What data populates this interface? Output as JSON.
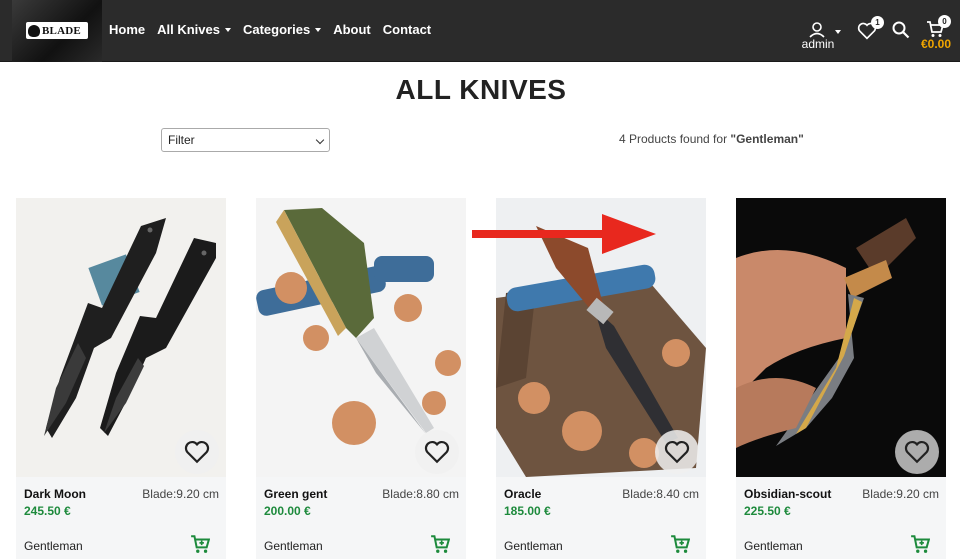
{
  "brand": {
    "logo_text": "BLADE"
  },
  "nav": {
    "home": "Home",
    "all_knives": "All Knives",
    "categories": "Categories",
    "about": "About",
    "contact": "Contact"
  },
  "user": {
    "label": "admin"
  },
  "wishlist": {
    "count": "1"
  },
  "cart": {
    "count": "0",
    "total": "€0.00"
  },
  "page": {
    "title": "ALL KNIVES"
  },
  "filter": {
    "selected": "Filter"
  },
  "results": {
    "prefix": "4 Products found for ",
    "query": "\"Gentleman\""
  },
  "products": [
    {
      "name": "Dark Moon",
      "blade": "Blade:9.20 cm",
      "price": "245.50 €",
      "category": "Gentleman"
    },
    {
      "name": "Green gent",
      "blade": "Blade:8.80 cm",
      "price": "200.00 €",
      "category": "Gentleman"
    },
    {
      "name": "Oracle",
      "blade": "Blade:8.40 cm",
      "price": "185.00 €",
      "category": "Gentleman"
    },
    {
      "name": "Obsidian-scout",
      "blade": "Blade:9.20 cm",
      "price": "225.50 €",
      "category": "Gentleman"
    }
  ],
  "colors": {
    "navbar": "#2b2b2b",
    "price": "#1d8a3c",
    "cart_total": "#f0a500",
    "annotation_arrow": "#e8281e"
  }
}
